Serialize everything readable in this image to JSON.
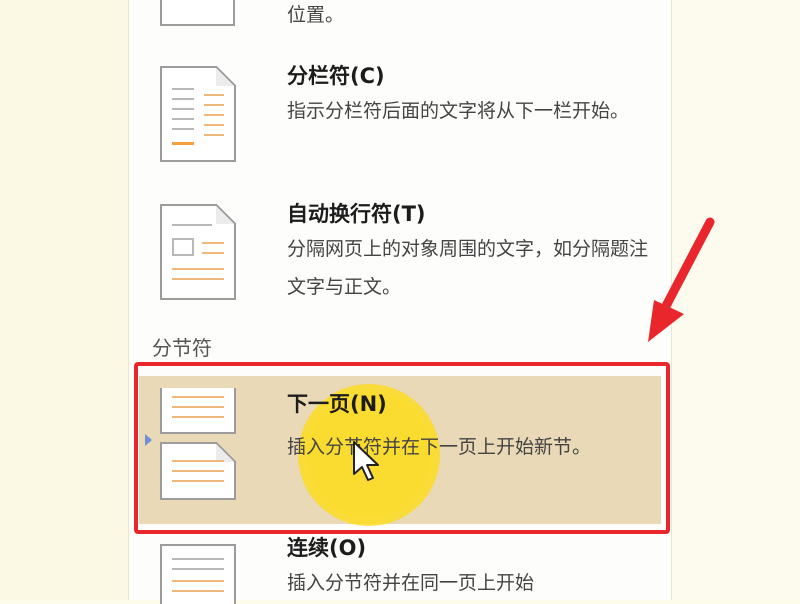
{
  "menu": {
    "top_partial_desc": "位置。",
    "column_break": {
      "title": "分栏符(C)",
      "desc": "指示分栏符后面的文字将从下一栏开始。"
    },
    "text_wrap_break": {
      "title": "自动换行符(T)",
      "desc": "分隔网页上的对象周围的文字，如分隔题注文字与正文。"
    },
    "section_label": "分节符",
    "next_page": {
      "title": "下一页(N)",
      "desc": "插入分节符并在下一页上开始新节。"
    },
    "continuous": {
      "title": "连续(O)",
      "desc": "插入分节符并在同一页上开始"
    }
  },
  "colors": {
    "highlight": "#ead9b6",
    "annotation_red": "#e8262c",
    "cursor_halo": "#fcdc1e"
  }
}
